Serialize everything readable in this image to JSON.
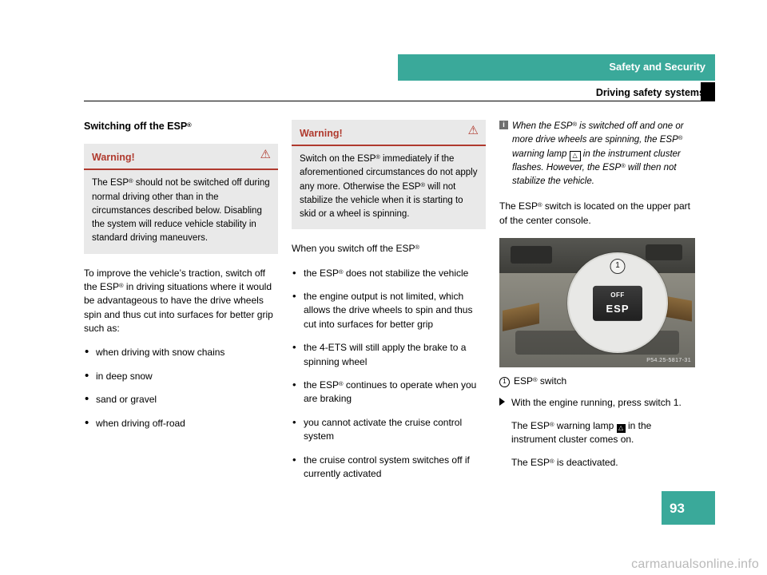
{
  "header": {
    "chapter_title": "Safety and Security",
    "section_title": "Driving safety systems",
    "bar_color": "#3aa99a"
  },
  "column1": {
    "heading": "Switching off the ESP",
    "heading_sup": "®",
    "warning": {
      "label": "Warning!",
      "icon": "warning-triangle-icon",
      "text_parts": [
        "The ESP",
        " should not be switched off during normal driving other than in the circumstances described below. Disabling the system will reduce vehicle stability in standard driving maneuvers."
      ],
      "accent_color": "#b03a2e",
      "background": "#e9e9e9"
    },
    "paragraph_parts": [
      "To improve the vehicle’s traction, switch off the ESP",
      " in driving situations where it would be advantageous to have the drive wheels spin and thus cut into surfaces for better grip such as:"
    ],
    "bullets": [
      "when driving with snow chains",
      "in deep snow",
      "sand or gravel",
      "when driving off-road"
    ]
  },
  "column2": {
    "warning": {
      "label": "Warning!",
      "icon": "warning-triangle-icon",
      "text_parts": [
        "Switch on the ESP",
        " immediately if the aforementioned circumstances do not apply any more. Otherwise the ESP",
        " will not stabilize the vehicle when it is starting to skid or a wheel is spinning."
      ]
    },
    "lead_parts": [
      "When you switch off the ESP",
      ""
    ],
    "bullets": [
      {
        "parts": [
          "the ESP",
          " does not stabilize the vehicle"
        ]
      },
      {
        "parts": [
          "the engine output is not limited, which allows the drive wheels to spin and thus cut into surfaces for better grip"
        ]
      },
      {
        "parts": [
          "the 4-ETS will still apply the brake to a spinning wheel"
        ]
      },
      {
        "parts": [
          "the ESP",
          " continues to operate when you are braking"
        ]
      },
      {
        "parts": [
          "you cannot activate the cruise control system"
        ]
      },
      {
        "parts": [
          "the cruise control system switches off if currently activated"
        ]
      }
    ]
  },
  "column3": {
    "note": {
      "icon": "info-icon",
      "parts": [
        "When the ESP",
        " is switched off and one or more drive wheels are spinning, the ESP",
        " warning lamp ",
        " in the instrument cluster flashes. However, the ESP",
        " will then not stabilize the vehicle."
      ],
      "lamp_icon": "esp-warning-lamp-icon"
    },
    "paragraph_parts": [
      "The ESP",
      " switch is located on the upper part of the center console."
    ],
    "image": {
      "name": "center-console-esp-switch-photo",
      "callout_number": "1",
      "switch_label_top": "OFF",
      "switch_label_main": "ESP",
      "image_code": "P54.25-5817-31"
    },
    "legend": {
      "number": "1",
      "parts": [
        "ESP",
        " switch"
      ]
    },
    "steps": [
      {
        "icon": "triangle-right-icon",
        "parts": [
          "With the engine running, press switch ",
          "1",
          "."
        ],
        "number": "1"
      }
    ],
    "sub_paragraphs": [
      {
        "parts": [
          "The ESP",
          " warning lamp ",
          " in the instrument cluster comes on."
        ]
      },
      {
        "parts": [
          "The ESP",
          " is deactivated."
        ]
      }
    ]
  },
  "footer": {
    "page_number": "93",
    "watermark": "carmanualsonline.info"
  }
}
